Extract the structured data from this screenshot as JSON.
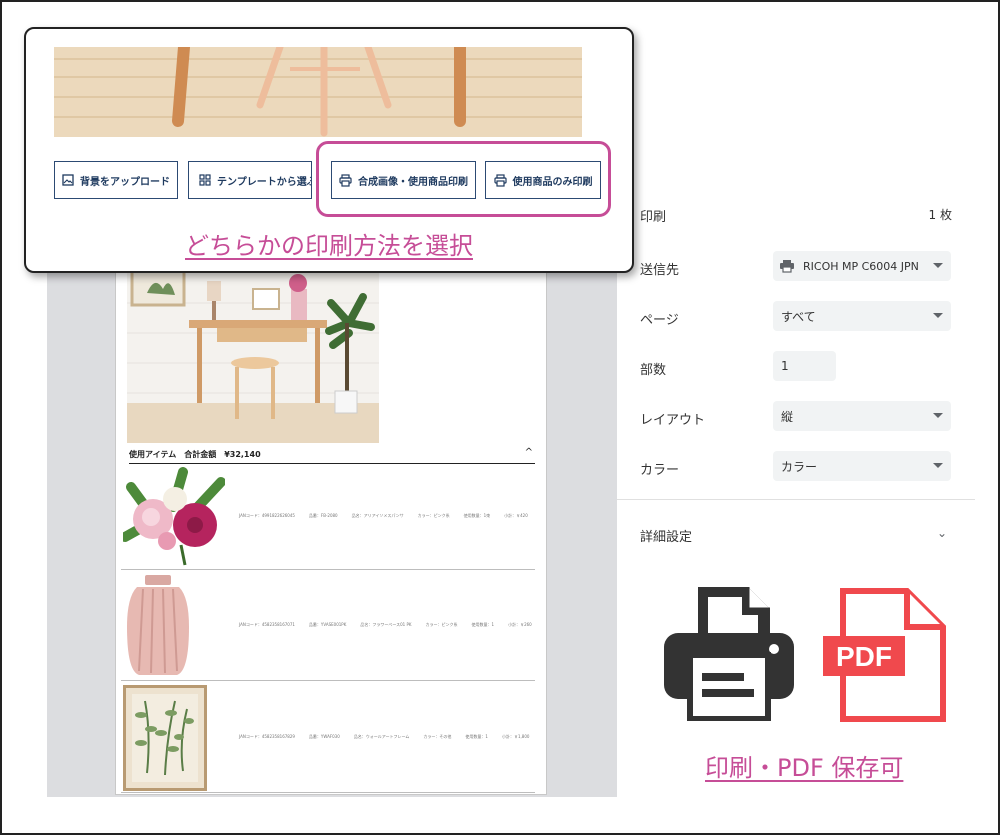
{
  "callout": {
    "buttons": [
      {
        "label": "背景をアップロード",
        "icon": "image-icon"
      },
      {
        "label": "テンプレートから選ぶ",
        "icon": "grid-icon"
      },
      {
        "label": "合成画像・使用商品印刷",
        "icon": "printer-icon"
      },
      {
        "label": "使用商品のみ印刷",
        "icon": "printer-icon"
      }
    ],
    "caption": "どちらかの印刷方法を選択",
    "highlight_color": "#c64d97"
  },
  "preview": {
    "items_header": "使用アイテム　合計金額　¥32,140",
    "collapse_icon": "^",
    "items": [
      {
        "jan": "JANコード：4991822626045",
        "code": "品番：FB-2080",
        "name": "品名：アリアイソメスパンサ",
        "color": "カラー：ピンク系",
        "qty": "使用数量：1束",
        "price": "小計：￥420"
      },
      {
        "jan": "JANコード：4582358167071",
        "code": "品番：YVASE001PK",
        "name": "品名：フラワーベース01 PK",
        "color": "カラー：ピンク系",
        "qty": "使用数量：1",
        "price": "小計：￥260"
      },
      {
        "jan": "JANコード：4582358167829",
        "code": "品番：YWAF030",
        "name": "品名：ウォールアートフレーム",
        "color": "カラー：その他",
        "qty": "使用数量：1",
        "price": "小計：￥1,800"
      }
    ]
  },
  "settings": {
    "title": "印刷",
    "sheet_count": "1 枚",
    "destination": {
      "label": "送信先",
      "value": "RICOH MP C6004 JPN",
      "icon": "printer-icon"
    },
    "pages": {
      "label": "ページ",
      "value": "すべて"
    },
    "copies": {
      "label": "部数",
      "value": "1"
    },
    "layout": {
      "label": "レイアウト",
      "value": "縦"
    },
    "color": {
      "label": "カラー",
      "value": "カラー"
    },
    "more": {
      "label": "詳細設定"
    }
  },
  "bottom": {
    "pdf_text": "PDF",
    "caption": "印刷・PDF 保存可",
    "printer_color": "#333333",
    "pdf_color": "#f0494d"
  }
}
